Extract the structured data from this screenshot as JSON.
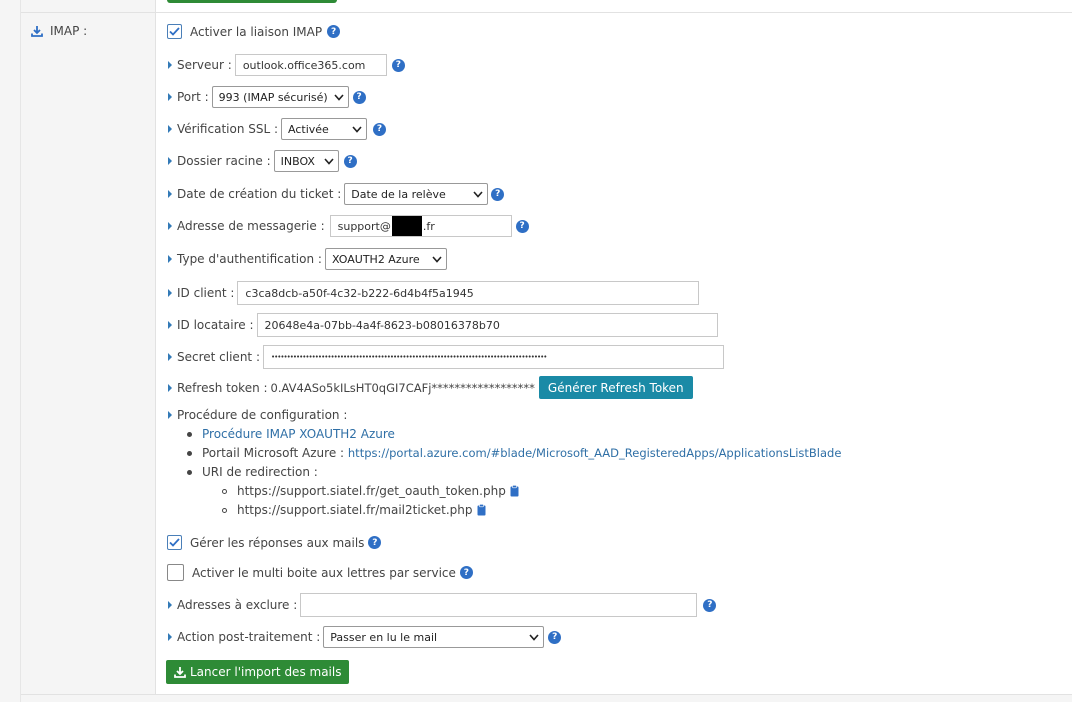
{
  "section": {
    "label": "IMAP :"
  },
  "activate": {
    "label": "Activer la liaison IMAP",
    "checked": true
  },
  "server": {
    "label": "Serveur :",
    "value": "outlook.office365.com"
  },
  "port": {
    "label": "Port :",
    "selected": "993 (IMAP sécurisé)"
  },
  "ssl": {
    "label": "Vérification SSL :",
    "selected": "Activée"
  },
  "root_folder": {
    "label": "Dossier racine :",
    "selected": "INBOX"
  },
  "ticket_date": {
    "label": "Date de création du ticket :",
    "selected": "Date de la relève"
  },
  "email": {
    "label": "Adresse de messagerie :",
    "value_prefix": "support@",
    "value_suffix": ".fr"
  },
  "auth_type": {
    "label": "Type d'authentification :",
    "selected": "XOAUTH2 Azure"
  },
  "client_id": {
    "label": "ID client :",
    "value": "c3ca8dcb-a50f-4c32-b222-6d4b4f5a1945"
  },
  "tenant_id": {
    "label": "ID locataire :",
    "value": "20648e4a-07bb-4a4f-8623-b08016378b70"
  },
  "client_secret": {
    "label": "Secret client :",
    "value": "••••••••••••••••••••••••••••••••••••••••••••••••••••••••••••••••••••••••••••••••••••••••"
  },
  "refresh_token": {
    "label": "Refresh token :",
    "value": "0.AV4ASo5kILsHT0qGI7CAFj******************",
    "button": "Générer Refresh Token"
  },
  "config": {
    "label": "Procédure de configuration :",
    "items": [
      {
        "text": "Procédure IMAP XOAUTH2 Azure"
      },
      {
        "prefix": "Portail Microsoft Azure : ",
        "link": "https://portal.azure.com/#blade/Microsoft_AAD_RegisteredApps/ApplicationsListBlade"
      },
      {
        "text": "URI de redirection :"
      }
    ],
    "redirect_uris": [
      "https://support.siatel.fr/get_oauth_token.php",
      "https://support.siatel.fr/mail2ticket.php"
    ]
  },
  "manage_replies": {
    "label": "Gérer les réponses aux mails",
    "checked": true
  },
  "multi_mailbox": {
    "label": "Activer le multi boite aux lettres par service",
    "checked": false
  },
  "exclude": {
    "label": "Adresses à exclure :",
    "value": ""
  },
  "post_action": {
    "label": "Action post-traitement :",
    "selected": "Passer en lu le mail"
  },
  "import_button": {
    "label": "Lancer l'import des mails"
  },
  "help_glyph": "?",
  "colors": {
    "accent": "#2f6fc5",
    "teal": "#1a8aa6",
    "green": "#2e8b36",
    "link": "#2f6fa6"
  }
}
